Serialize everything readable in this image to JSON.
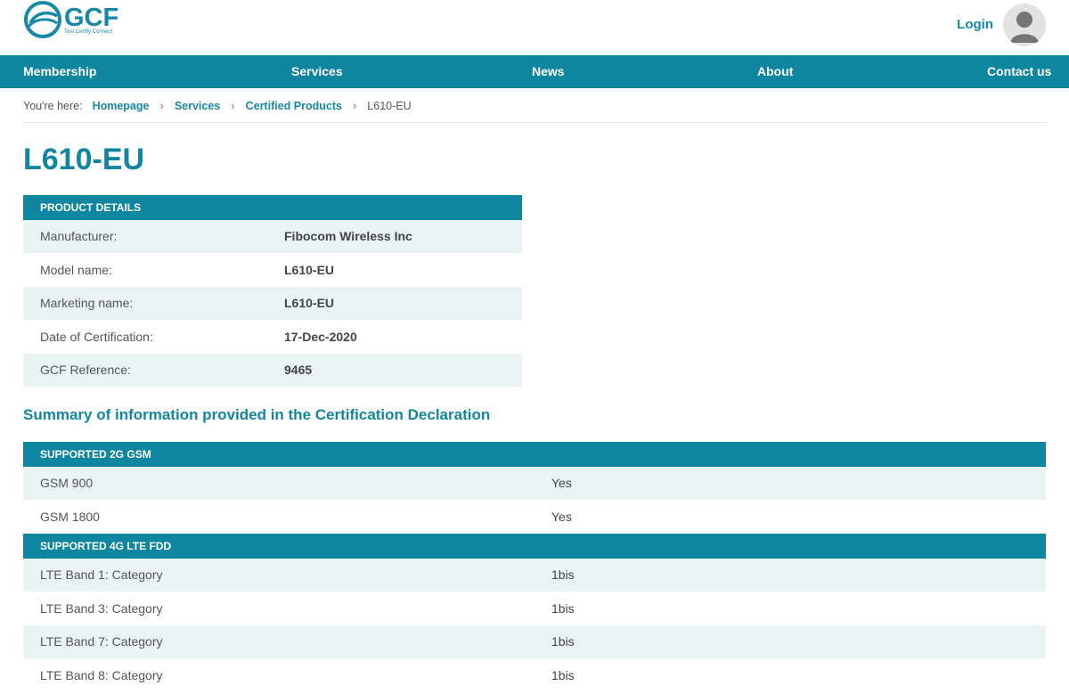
{
  "header": {
    "logo_text": "GCF",
    "logo_tagline": "Test Certify Connect",
    "login_label": "Login"
  },
  "nav": {
    "items": [
      "Membership",
      "Services",
      "News",
      "About",
      "Contact us"
    ]
  },
  "breadcrumb": {
    "label": "You're here:",
    "links": [
      "Homepage",
      "Services",
      "Certified Products"
    ],
    "current": "L610-EU"
  },
  "page": {
    "title": "L610-EU"
  },
  "product_details": {
    "heading": "PRODUCT DETAILS",
    "rows": [
      {
        "label": "Manufacturer:",
        "value": "Fibocom Wireless Inc"
      },
      {
        "label": "Model name:",
        "value": "L610-EU"
      },
      {
        "label": "Marketing name:",
        "value": "L610-EU"
      },
      {
        "label": "Date of Certification:",
        "value": "17-Dec-2020"
      },
      {
        "label": "GCF Reference:",
        "value": "9465"
      }
    ]
  },
  "summary": {
    "title": "Summary of information provided in the Certification Declaration",
    "sections": [
      {
        "heading": "SUPPORTED 2G GSM",
        "rows": [
          {
            "label": "GSM 900",
            "value": "Yes"
          },
          {
            "label": "GSM 1800",
            "value": "Yes"
          }
        ]
      },
      {
        "heading": "SUPPORTED 4G LTE FDD",
        "rows": [
          {
            "label": "LTE Band 1: Category",
            "value": "1bis"
          },
          {
            "label": "LTE Band 3: Category",
            "value": "1bis"
          },
          {
            "label": "LTE Band 7: Category",
            "value": "1bis"
          },
          {
            "label": "LTE Band 8: Category",
            "value": "1bis"
          }
        ]
      }
    ]
  },
  "colors": {
    "brand": "#0f86a0",
    "row_alt": "#e9f3f4"
  }
}
